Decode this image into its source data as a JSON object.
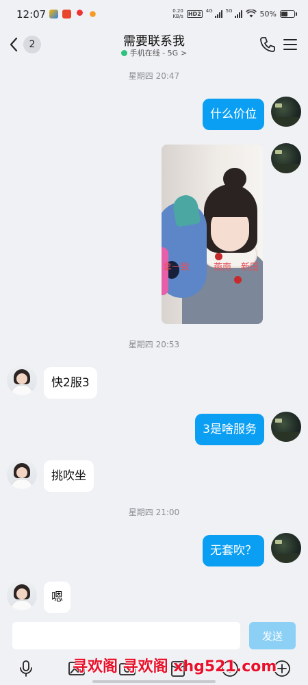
{
  "status_bar": {
    "time": "12:07",
    "net_speed_value": "0.20",
    "net_speed_unit": "KB/s",
    "hd_badge": "HD",
    "hd_sub": "2",
    "signal1": "4G",
    "signal2": "5G",
    "battery": "50%"
  },
  "header": {
    "unread_count": "2",
    "title": "需要联系我",
    "status_text": "手机在线 - 5G",
    "status_chevron": ">"
  },
  "timestamps": {
    "t1": "星期四 20:47",
    "t2": "星期四 20:53",
    "t3": "星期四 21:00"
  },
  "messages": {
    "m1": "什么价位",
    "m3": "快2服3",
    "m4": "3是啥服务",
    "m5": "挑吹坐",
    "m6": "无套吹？",
    "m7": "嗯"
  },
  "photo_watermark": {
    "left": "拿一致",
    "mid": "燕南",
    "right": "新田"
  },
  "input": {
    "placeholder": "",
    "send_label": "发送"
  },
  "promo_text": "寻欢阁 寻欢阁 xhg521.com",
  "icons": [
    "chevron-left-icon",
    "phone-icon",
    "menu-icon",
    "mic-icon",
    "image-icon",
    "camera-icon",
    "emoji-icon",
    "plus-icon"
  ],
  "colors": {
    "accent": "#0b9ff3",
    "send_disabled": "#8dd0f6",
    "online": "#2ec27e",
    "background": "#f0f1f4"
  }
}
